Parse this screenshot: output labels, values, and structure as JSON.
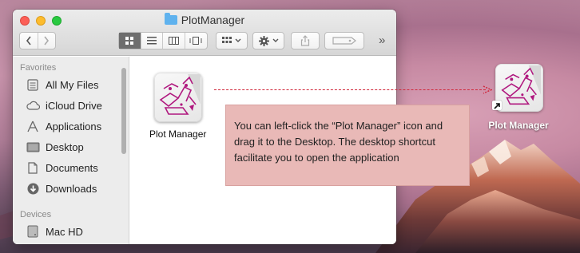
{
  "window": {
    "title": "PlotManager"
  },
  "toolbar": {
    "back_icon": "chevron-left-icon",
    "forward_icon": "chevron-right-icon",
    "view_modes": [
      "icon-view",
      "list-view",
      "column-view",
      "cover-flow-view"
    ],
    "arrange_icon": "arrange-grid-icon",
    "action_icon": "gear-icon",
    "share_icon": "share-icon",
    "tags_icon": "tag-icon",
    "overflow_label": "»"
  },
  "sidebar": {
    "favorites_heading": "Favorites",
    "favorites": [
      {
        "label": "All My Files",
        "icon": "all-files-icon"
      },
      {
        "label": "iCloud Drive",
        "icon": "cloud-icon"
      },
      {
        "label": "Applications",
        "icon": "applications-icon"
      },
      {
        "label": "Desktop",
        "icon": "desktop-icon"
      },
      {
        "label": "Documents",
        "icon": "documents-icon"
      },
      {
        "label": "Downloads",
        "icon": "downloads-icon"
      }
    ],
    "devices_heading": "Devices",
    "devices": [
      {
        "label": "Mac HD",
        "icon": "hard-drive-icon"
      }
    ]
  },
  "content": {
    "app_name": "Plot Manager"
  },
  "callout": {
    "text": "You can left-click the “Plot Manager” icon and drag it to the Desktop. The desktop shortcut facilitate you to open the application"
  },
  "desktop": {
    "shortcut_label": "Plot Manager"
  },
  "colors": {
    "arrow": "#d0283c",
    "callout_bg": "#e9b9b7",
    "app_icon_magenta": "#b0187f"
  }
}
